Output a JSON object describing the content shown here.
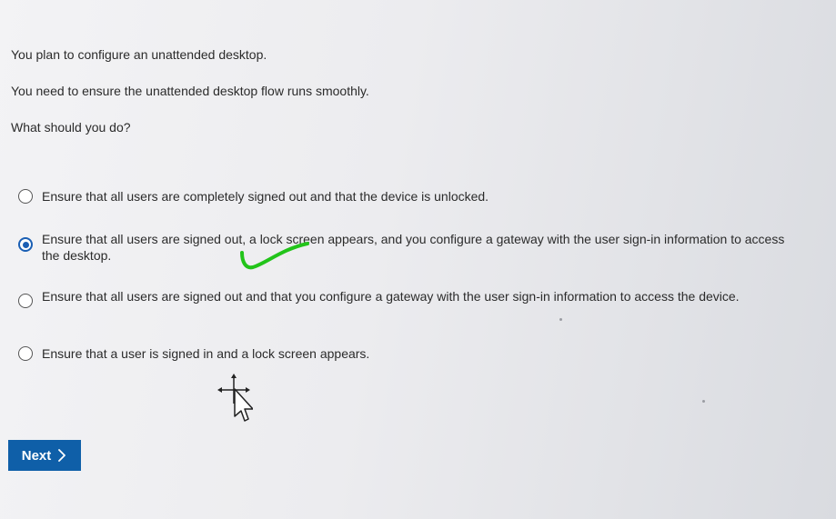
{
  "question": {
    "line1": "You plan to configure an unattended desktop.",
    "line2": "You need to ensure the unattended desktop flow runs smoothly.",
    "line3": "What should you do?"
  },
  "options": [
    {
      "label": "Ensure that all users are completely signed out and that the device is unlocked.",
      "selected": false
    },
    {
      "label": "Ensure that all users are signed out, a lock screen appears, and you configure a gateway with the user sign-in information to access the desktop.",
      "selected": true
    },
    {
      "label": "Ensure that all users are signed out and that you configure a gateway with the user sign-in information to access the device.",
      "selected": false
    },
    {
      "label": "Ensure that a user is signed in and a lock screen appears.",
      "selected": false
    }
  ],
  "next_button": {
    "label": "Next",
    "icon": "chevron-right-icon"
  },
  "colors": {
    "accent": "#0f5fa8",
    "radio_selected": "#1a5fb4",
    "annotation": "#22c41a"
  }
}
